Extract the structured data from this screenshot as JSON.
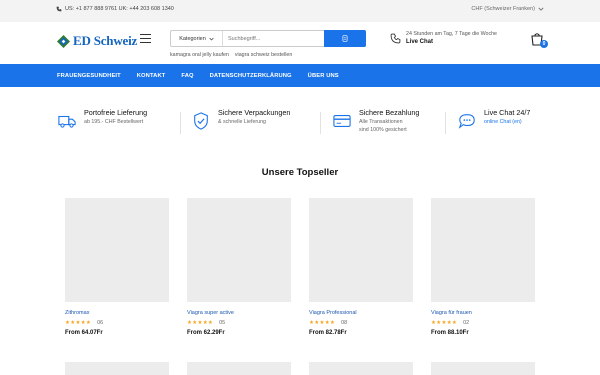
{
  "topbar": {
    "phone_text": "US: +1 877 888 9761 UK: +44 203 608 1340",
    "currency_text": "CHF (Schweizer Franken)"
  },
  "header": {
    "logo_text": "ED Schweiz",
    "category_label": "Kategorien",
    "search_placeholder": "Suchbegriff...",
    "suggestions": [
      "kamagra oral jelly kaufen",
      "viagra schweiz bestellen"
    ],
    "chat_line1": "24 Stunden am Tag, 7 Tage die Woche",
    "chat_line2": "Live Chat",
    "cart_count": "0"
  },
  "nav": {
    "items": [
      "FRAUENGESUNDHEIT",
      "KONTAKT",
      "FAQ",
      "DATENSCHUTZERKLÄRUNG",
      "ÜBER UNS"
    ]
  },
  "features": [
    {
      "title": "Portofreie Lieferung",
      "sub1": "ab 195.- CHF Bestellwert",
      "sub2": "",
      "icon": "truck-icon"
    },
    {
      "title": "Sichere Verpackungen",
      "sub1": "& schnelle Lieferung",
      "sub2": "",
      "icon": "shield-check-icon"
    },
    {
      "title": "Sichere Bezahlung",
      "sub1": "Alle Transaktionen",
      "sub2": "sind 100% gesichert",
      "icon": "credit-card-icon"
    },
    {
      "title": "Live Chat 24/7",
      "sub1": "online Chat (en)",
      "sub2": "",
      "icon": "chat-bubble-icon"
    }
  ],
  "section_title": "Unsere Topseller",
  "products": [
    {
      "name": "Zithromax",
      "stars": "★★★★★",
      "count": "06",
      "price": "From 64.07Fr"
    },
    {
      "name": "Viagra super active",
      "stars": "★★★★★",
      "count": "05",
      "price": "From 62.29Fr"
    },
    {
      "name": "Viagra Professional",
      "stars": "★★★★★",
      "count": "08",
      "price": "From 82.78Fr"
    },
    {
      "name": "Viagra für frauen",
      "stars": "★★★★★",
      "count": "02",
      "price": "From 88.10Fr"
    }
  ],
  "colors": {
    "accent": "#1a73e8",
    "star": "#f5a623",
    "topbar_bg": "#f3f3f3",
    "placeholder_bg": "#ececec"
  }
}
